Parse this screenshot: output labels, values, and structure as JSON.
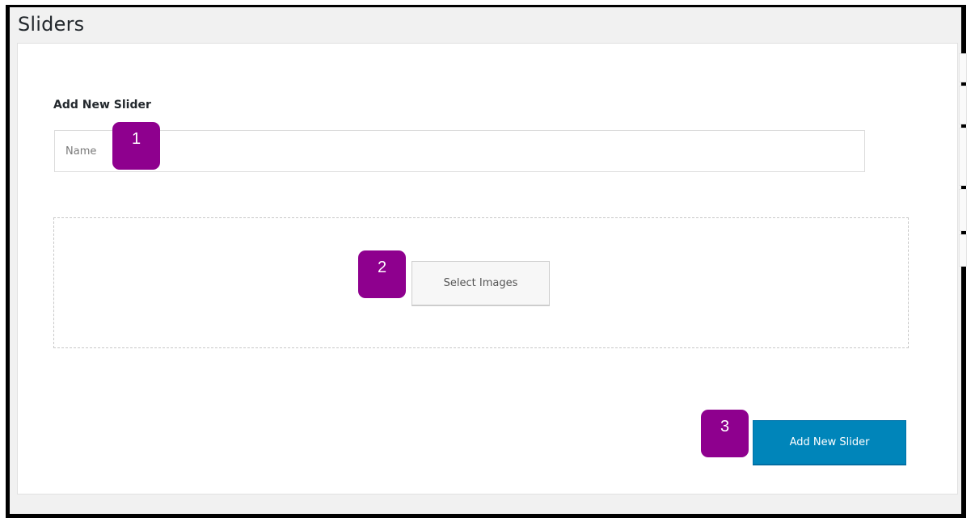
{
  "page": {
    "title": "Sliders"
  },
  "form": {
    "heading": "Add New Slider",
    "name_placeholder": "Name",
    "name_value": "",
    "select_images_label": "Select Images",
    "submit_label": "Add New Slider"
  },
  "annotations": {
    "step_1": "1",
    "step_2": "2",
    "step_3": "3",
    "badge_color": "#8e008e"
  },
  "colors": {
    "primary_button": "#0085ba",
    "background": "#f1f1f1",
    "panel": "#ffffff"
  }
}
